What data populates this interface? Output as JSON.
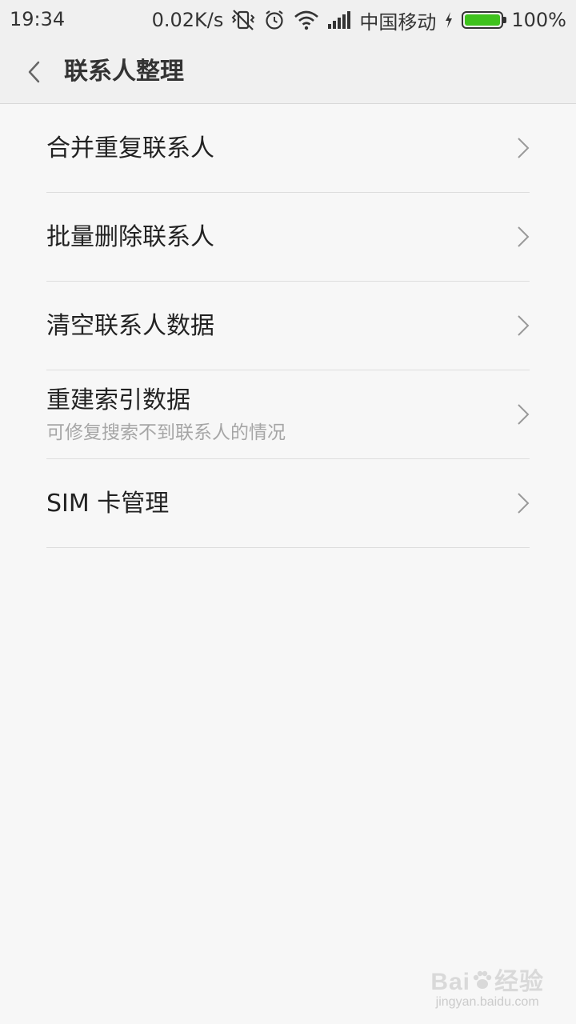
{
  "status_bar": {
    "time": "19:34",
    "net_speed": "0.02K/s",
    "carrier": "中国移动",
    "battery_percent": "100%",
    "battery_level": 1.0,
    "battery_color": "#3ec21c",
    "icons": [
      "vibrate-off-icon",
      "alarm-icon",
      "wifi-icon",
      "signal-icon",
      "charging-icon",
      "battery-icon"
    ]
  },
  "header": {
    "title": "联系人整理",
    "back_icon": "chevron-left-icon"
  },
  "menu": {
    "items": [
      {
        "label": "合并重复联系人"
      },
      {
        "label": "批量删除联系人"
      },
      {
        "label": "清空联系人数据"
      },
      {
        "label": "重建索引数据",
        "sublabel": "可修复搜索不到联系人的情况"
      },
      {
        "label": "SIM 卡管理"
      }
    ]
  },
  "watermark": {
    "brand_prefix": "Bai",
    "brand_suffix": "经验",
    "site": "jingyan.baidu.com"
  }
}
